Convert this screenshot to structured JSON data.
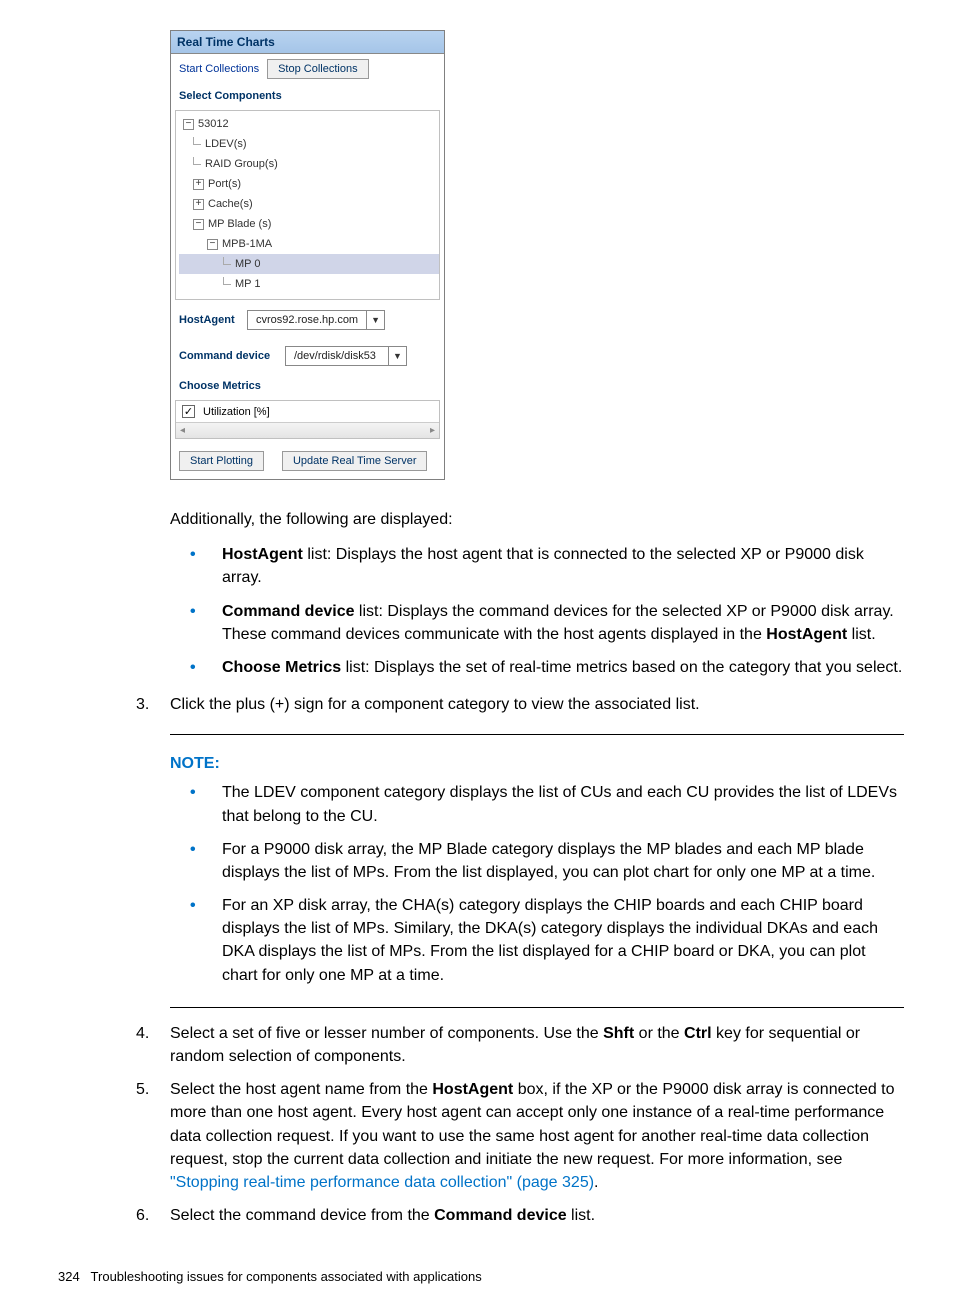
{
  "panel": {
    "title": "Real Time Charts",
    "start_collections": "Start Collections",
    "stop_collections": "Stop Collections",
    "select_components": "Select Components",
    "tree": {
      "root": "53012",
      "ldev": "LDEV(s)",
      "raid": "RAID Group(s)",
      "ports": "Port(s)",
      "cache": "Cache(s)",
      "mpblade": "MP Blade (s)",
      "mpb1ma": "MPB-1MA",
      "mp0": "MP 0",
      "mp1": "MP 1"
    },
    "hostagent_label": "HostAgent",
    "hostagent_value": "cvros92.rose.hp.com",
    "command_device_label": "Command device",
    "command_device_value": "/dev/rdisk/disk53",
    "choose_metrics": "Choose Metrics",
    "metric_util": "Utilization [%]",
    "start_plotting": "Start Plotting",
    "update_server": "Update Real Time Server"
  },
  "doc": {
    "intro": "Additionally, the following are displayed:",
    "b1_bold": "HostAgent",
    "b1_rest": " list: Displays the host agent that is connected to the selected XP or P9000 disk array.",
    "b2_bold": "Command device",
    "b2_rest": " list: Displays the command devices for the selected XP or P9000 disk array. These command devices communicate with the host agents displayed in the ",
    "b2_bold2": "HostAgent",
    "b2_rest2": " list.",
    "b3_bold": "Choose Metrics",
    "b3_rest": " list: Displays the set of real-time metrics based on the category that you select.",
    "step3": "Click the plus (+) sign for a component category to view the associated list.",
    "note_label": "NOTE:",
    "note1": "The LDEV component category displays the list of CUs and each CU provides the list of LDEVs that belong to the CU.",
    "note2": "For a P9000 disk array, the MP Blade category displays the MP blades and each MP blade displays the list of MPs. From the list displayed, you can plot chart for only one MP at a time.",
    "note3": "For an XP disk array, the CHA(s) category displays the CHIP boards and each CHIP board displays the list of MPs. Similary, the DKA(s) category displays the individual DKAs and each DKA displays the list of MPs. From the list displayed for a CHIP board or DKA, you can plot chart for only one MP at a time.",
    "step4_a": "Select a set of five or lesser number of components. Use the ",
    "step4_shft": "Shft",
    "step4_b": " or the ",
    "step4_ctrl": "Ctrl",
    "step4_c": " key for sequential or random selection of components.",
    "step5_a": "Select the host agent name from the ",
    "step5_bold": "HostAgent",
    "step5_b": " box, if the XP or the P9000 disk array is connected to more than one host agent. Every host agent can accept only one instance of a real-time performance data collection request. If you want to use the same host agent for another real-time data collection request, stop the current data collection and initiate the new request. For more information, see ",
    "step5_link": "\"Stopping real-time performance data collection\" (page 325)",
    "step5_c": ".",
    "step6_a": "Select the command device from the ",
    "step6_bold": "Command device",
    "step6_b": " list.",
    "footer_page": "324",
    "footer_text": "Troubleshooting issues for components associated with applications"
  }
}
